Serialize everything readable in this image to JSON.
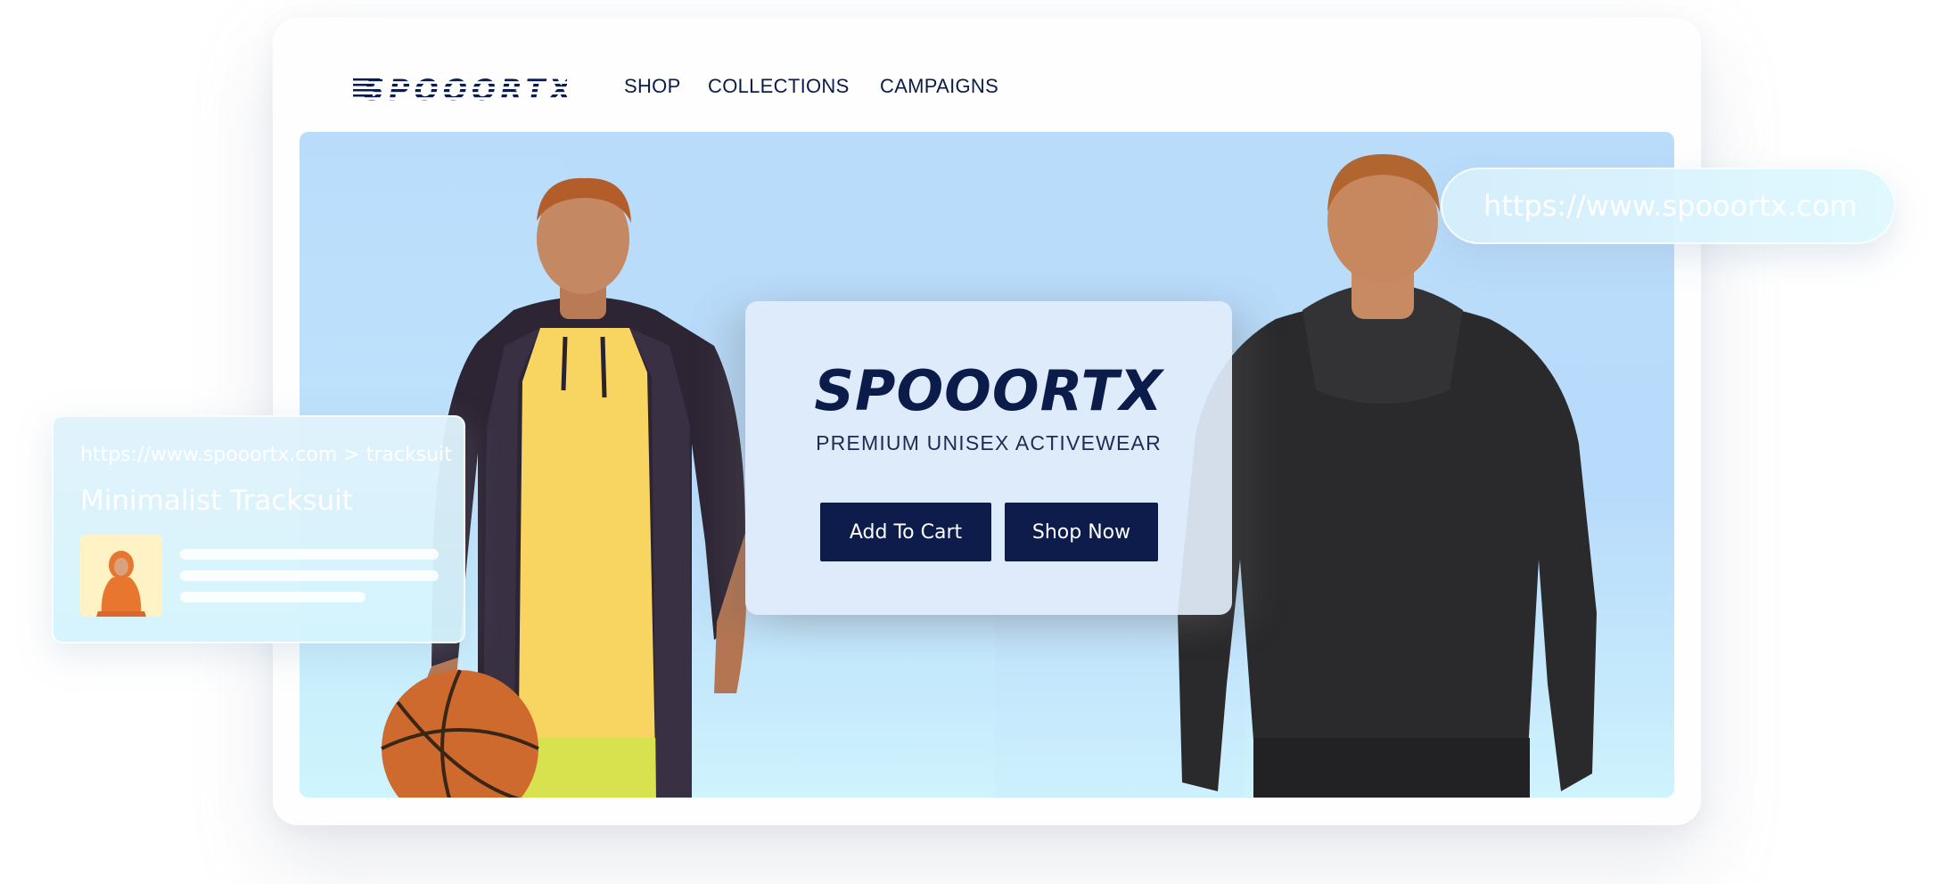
{
  "nav": {
    "logo_text": "SPOOORTX",
    "links": [
      "SHOP",
      "COLLECTIONS",
      "CAMPAIGNS"
    ]
  },
  "hero": {
    "brand": "SPOOORTX",
    "tagline": "PREMIUM UNISEX ACTIVEWEAR",
    "add_to_cart": "Add To Cart",
    "shop_now": "Shop Now"
  },
  "url_pill": {
    "url": "https://www.spooortx.com"
  },
  "search_result": {
    "url": "https://www.spooortx.com > tracksuit",
    "title": "Minimalist Tracksuit"
  },
  "colors": {
    "navy": "#0d1c4b",
    "hero_blue": "#b9dcfb",
    "card": "#fefefe"
  },
  "icons": [
    "spooortx-logo",
    "basketball-image",
    "model-image",
    "product-thumbnail"
  ]
}
